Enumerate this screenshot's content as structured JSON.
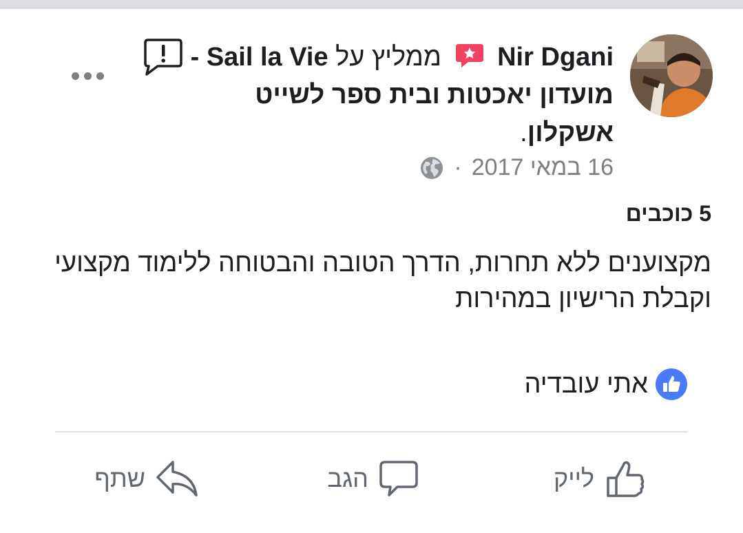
{
  "post": {
    "author": "Nir Dgani",
    "verb": "ממליץ על",
    "page_name": "Sail la Vie - מועדון יאכטות ובית ספר לשייט אשקלון",
    "period": ".",
    "date": "16 במאי 2017",
    "separator": "·",
    "privacy_icon": "globe-icon",
    "rating_text": "5 כוכבים",
    "review_text": "מקצוענים ללא תחרות, הדרך הטובה והבטוחה ללימוד מקצועי וקבלת הרישיון במהירות"
  },
  "reactions": {
    "liked_by": "אתי עובדיה",
    "icon": "like-badge-icon"
  },
  "actions": {
    "like_label": "לייק",
    "comment_label": "הגב",
    "share_label": "שתף"
  },
  "colors": {
    "recommend_badge": "#f3425f",
    "like_blue": "#4a7bf7",
    "meta_gray": "#7b7f86"
  }
}
